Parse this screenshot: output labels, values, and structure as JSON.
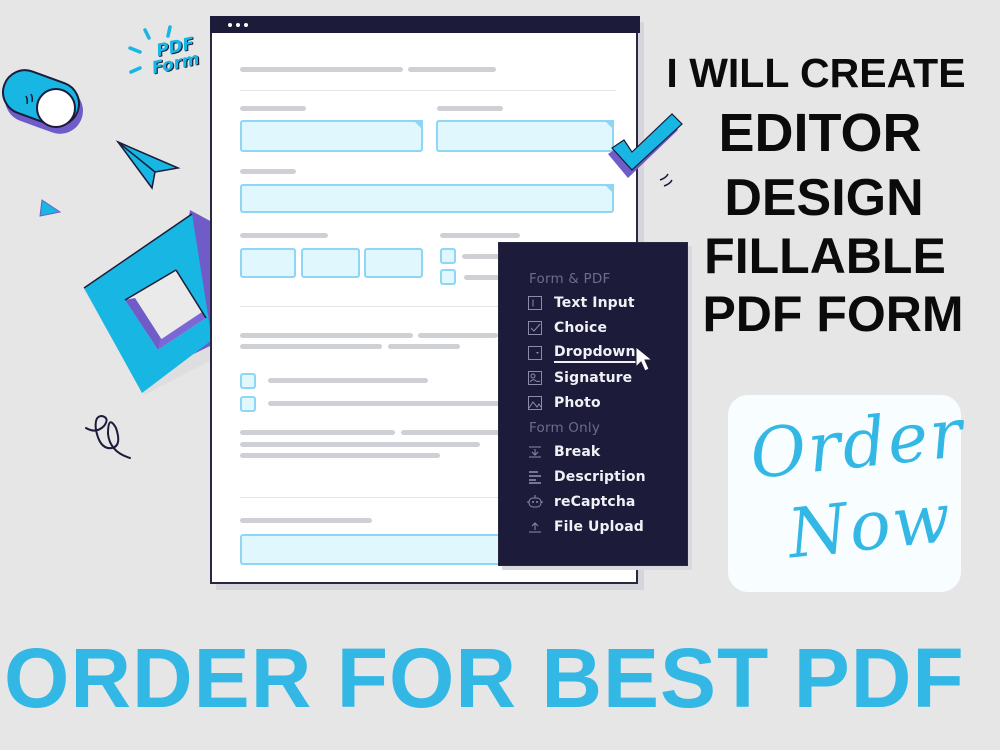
{
  "sticker": {
    "label_line1": "PDF",
    "label_line2": "Form"
  },
  "window": {
    "dots": [
      "dot",
      "dot",
      "dot"
    ]
  },
  "menu": {
    "section1": "Form & PDF",
    "items1": [
      {
        "label": "Text Input",
        "icon": "text-input-icon"
      },
      {
        "label": "Choice",
        "icon": "checkbox-icon"
      },
      {
        "label": "Dropdown",
        "icon": "dropdown-icon",
        "hovered": true
      },
      {
        "label": "Signature",
        "icon": "signature-icon"
      },
      {
        "label": "Photo",
        "icon": "photo-icon"
      }
    ],
    "section2": "Form Only",
    "items2": [
      {
        "label": "Break",
        "icon": "break-icon"
      },
      {
        "label": "Description",
        "icon": "description-icon"
      },
      {
        "label": "reCaptcha",
        "icon": "robot-icon"
      },
      {
        "label": "File Upload",
        "icon": "upload-icon"
      }
    ]
  },
  "headline": {
    "line1": "I WILL CREATE",
    "line2": "EDITOR",
    "line3": "DESIGN",
    "line4": "FILLABLE",
    "line5": "PDF FORM"
  },
  "order_card": {
    "line1": "Order",
    "line2": "Now"
  },
  "banner": {
    "text": "ORDER FOR BEST PDF"
  },
  "colors": {
    "background": "#e6e6e6",
    "accent_blue": "#33b7e4",
    "cyan": "#17b6e3",
    "purple": "#6f5cc9",
    "navy": "#1c1b3a",
    "field_fill": "#e0f7fd",
    "field_border": "#8fd5f5"
  }
}
